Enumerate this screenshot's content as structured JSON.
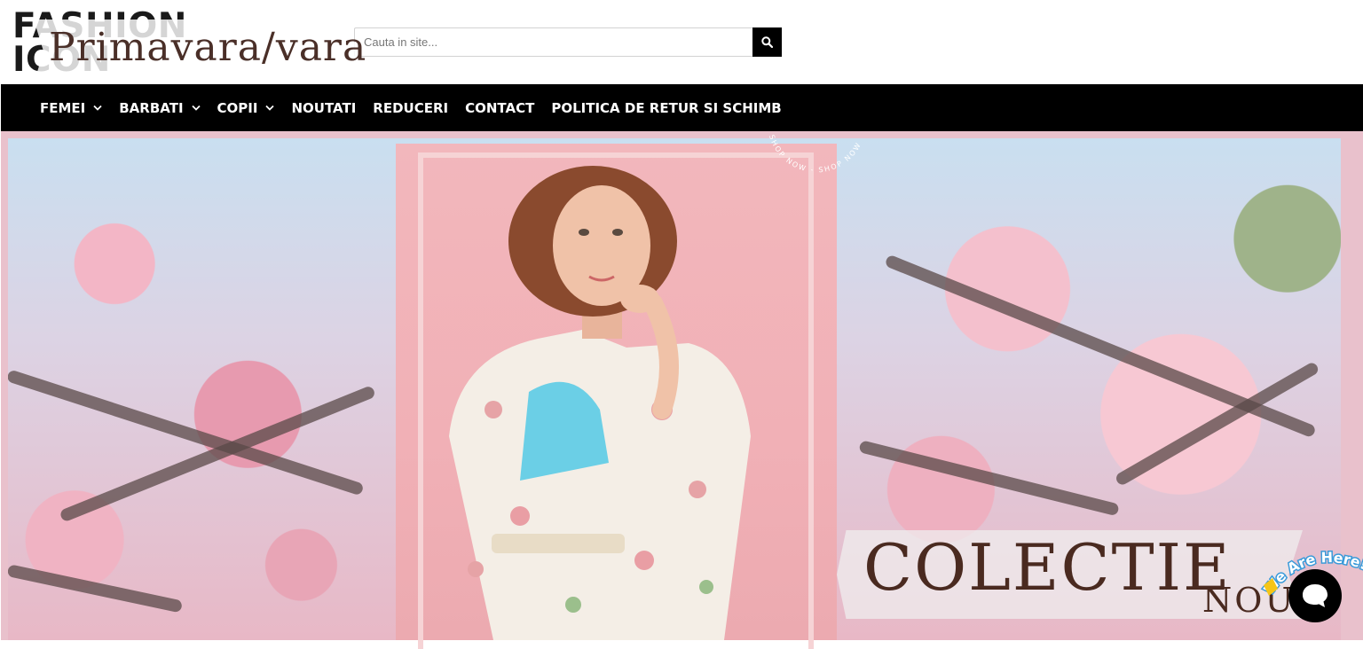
{
  "header": {
    "logo": {
      "line1": "FASHION",
      "line2": "ICON"
    },
    "search": {
      "placeholder": "Cauta in site...",
      "button_icon": "search-icon"
    }
  },
  "nav": {
    "items": [
      {
        "label": "FEMEI",
        "has_dropdown": true
      },
      {
        "label": "BARBATI",
        "has_dropdown": true
      },
      {
        "label": "COPII",
        "has_dropdown": true
      },
      {
        "label": "NOUTATI",
        "has_dropdown": false
      },
      {
        "label": "REDUCERI",
        "has_dropdown": false
      },
      {
        "label": "CONTACT",
        "has_dropdown": false
      },
      {
        "label": "POLITICA DE RETUR SI SCHIMB",
        "has_dropdown": false
      }
    ]
  },
  "hero": {
    "banner_title": "Primavara/vara",
    "stamp": "SHOP NOW - SHOP NOW - SH",
    "collection_title": "COLECTIE",
    "collection_subtitle": "NOU"
  },
  "chat": {
    "label": "We Are Here!",
    "icon": "chat-bubble-icon"
  },
  "colors": {
    "nav_bg": "#000000",
    "nav_text": "#ffffff",
    "hero_border": "#e9c1cc",
    "accent_pink": "#f2b7bc"
  }
}
